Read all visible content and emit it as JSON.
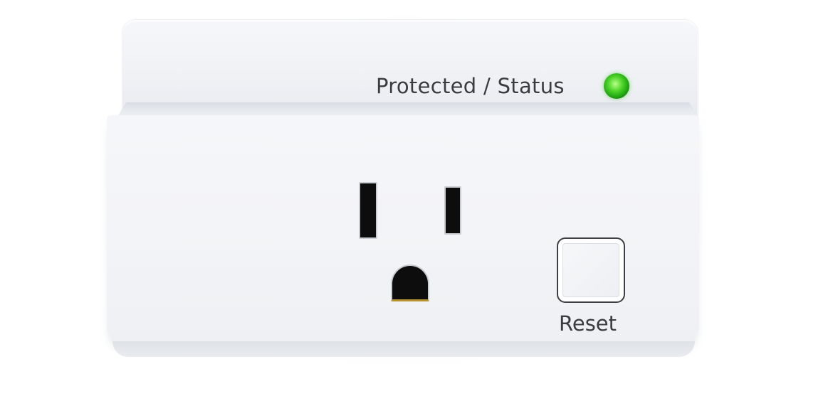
{
  "device": {
    "status_label": "Protected / Status",
    "led_color": "#3fcc24",
    "reset_label": "Reset",
    "body_color": "#f3f4f7",
    "slot_color": "#0d0d0e"
  }
}
